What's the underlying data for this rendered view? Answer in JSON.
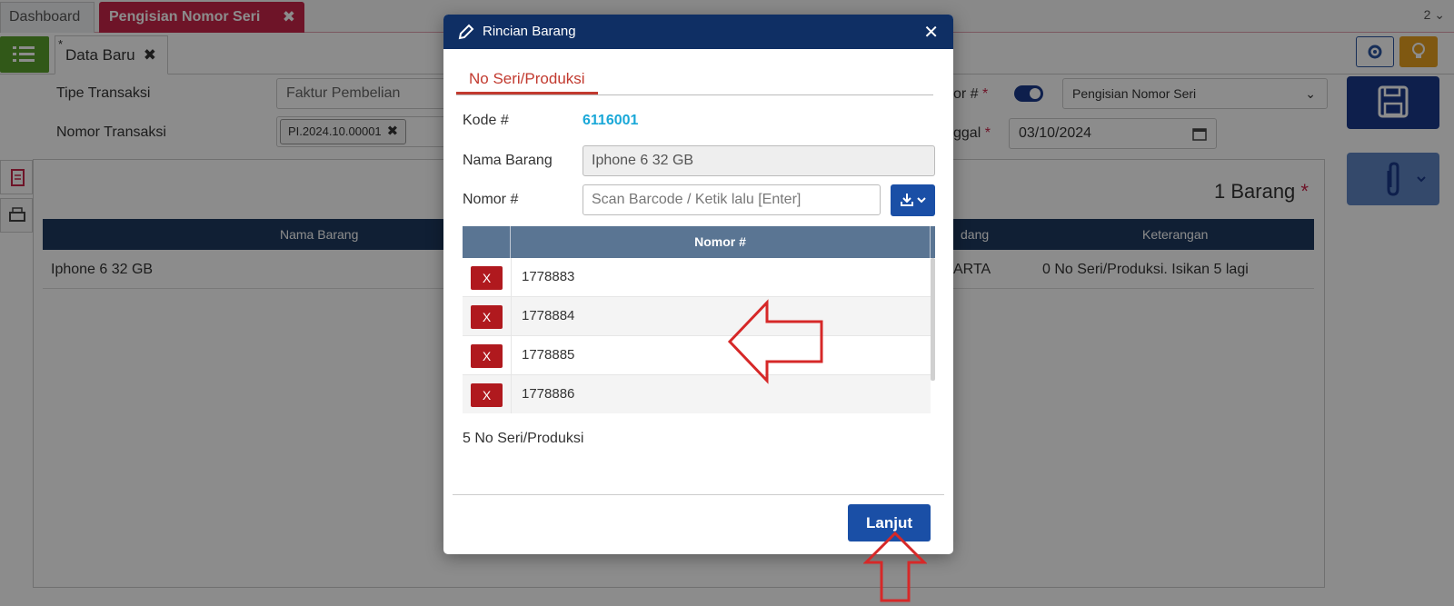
{
  "tabs": {
    "dashboard": "Dashboard",
    "active": "Pengisian Nomor Seri",
    "close": "✖",
    "count": "2 ⌄"
  },
  "subtab": {
    "star": "*",
    "label": "Data Baru",
    "close": "✖"
  },
  "form": {
    "tipe_label": "Tipe Transaksi",
    "tipe_value": "Faktur Pembelian",
    "nomor_label": "Nomor Transaksi",
    "nomor_chip": "PI.2024.10.00001",
    "chip_close": "✖",
    "mode_label_partial": "or #",
    "mode_value": "Pengisian Nomor Seri",
    "tanggal_label_partial": "ggal",
    "tanggal_value": "03/10/2024",
    "required_mark": "*"
  },
  "panel": {
    "count_label": "1 Barang",
    "required_mark": "*",
    "columns": {
      "nama": "Nama Barang",
      "gudang_partial": "dang",
      "keterangan": "Keterangan"
    },
    "row": {
      "nama": "Iphone 6 32 GB",
      "gudang_partial": "ARTA",
      "keterangan": "0 No Seri/Produksi. Isikan 5 lagi"
    }
  },
  "modal": {
    "title": "Rincian Barang",
    "close": "✕",
    "tab": "No Seri/Produksi",
    "kode_label": "Kode #",
    "kode_value": "6116001",
    "nama_label": "Nama Barang",
    "nama_value": "Iphone 6 32 GB",
    "nomor_label": "Nomor #",
    "nomor_placeholder": "Scan Barcode / Ketik lalu [Enter]",
    "table_header": "Nomor #",
    "delete_label": "X",
    "serials": [
      "1778883",
      "1778884",
      "1778885",
      "1778886"
    ],
    "count_text": "5 No Seri/Produksi",
    "continue_label": "Lanjut"
  },
  "colors": {
    "header": "#0f2f64",
    "accent": "#c8254a",
    "primary_button": "#1a4fa6",
    "delete_button": "#b0191e",
    "annotation_arrow": "#d62828"
  }
}
